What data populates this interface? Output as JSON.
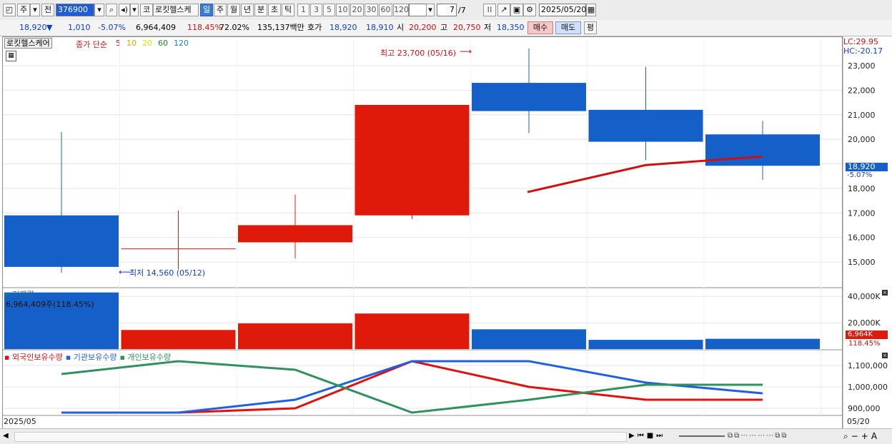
{
  "toolbar": {
    "type_label": "주",
    "prev_label": "전",
    "code": "376900",
    "market_btn": "코",
    "stock_name": "로킷헬스케",
    "periods": [
      "일",
      "주",
      "월",
      "년",
      "분",
      "초",
      "틱"
    ],
    "selected_period": "일",
    "intervals": [
      "1",
      "3",
      "5",
      "10",
      "20",
      "30",
      "60",
      "120"
    ],
    "page": "7",
    "page_total": "/7",
    "date": "2025/05/20"
  },
  "quote": {
    "price": "18,920",
    "arrow": "▼",
    "change": "1,010",
    "change_pct": "-5.07%",
    "volume": "6,964,409",
    "volume_ratio": "118.45%",
    "turnover": "72.02%",
    "amount": "135,137백만",
    "bid_label": "호가",
    "bid1": "18,920",
    "bid2": "18,910",
    "open_label": "시",
    "open": "20,200",
    "high_label": "고",
    "high": "20,750",
    "low_label": "저",
    "low": "18,350",
    "buy_label": "매수",
    "sell_label": "매도",
    "avg_label": "평"
  },
  "price_panel": {
    "name_label": "로킷헬스케어",
    "ma_prefix": "종가 단순",
    "ma_periods": [
      {
        "label": "5",
        "color": "#e01010"
      },
      {
        "label": "10",
        "color": "#f0a000"
      },
      {
        "label": "20",
        "color": "#e8e000"
      },
      {
        "label": "60",
        "color": "#208020"
      },
      {
        "label": "120",
        "color": "#2080c0"
      }
    ],
    "lc": "LC:29.95",
    "hc": "HC:-20.17",
    "high_note": "최고 23,700 (05/16)",
    "low_note": "최저 14,560 (05/12)",
    "last_price_tag": "18,920",
    "last_change_tag": "-5.07%",
    "y_ticks": [
      "23,000",
      "22,000",
      "21,000",
      "20,000",
      "18,000",
      "17,000",
      "16,000",
      "15,000"
    ]
  },
  "volume_panel": {
    "title": "거래량",
    "value_note": "6,964,409주(118.45%)",
    "y_ticks": [
      "40,000K",
      "20,000K"
    ],
    "last_tag": "6,964K",
    "last_pct": "118.45%"
  },
  "holdings_panel": {
    "legend": [
      {
        "label": "외국인보유수량",
        "color": "#e01010"
      },
      {
        "label": "기관보유수량",
        "color": "#2060e0"
      },
      {
        "label": "개인보유수량",
        "color": "#309060"
      }
    ],
    "y_ticks": [
      "1,100,000",
      "1,000,000",
      "900,000"
    ]
  },
  "x_axis": {
    "start": "2025/05",
    "end": "05/20"
  },
  "chart_data": {
    "type": "candlestick",
    "y_range": [
      14000,
      24000
    ],
    "candles": [
      {
        "open": 16900,
        "high": 20300,
        "low": 14560,
        "close": 14800,
        "color": "#1560c8"
      },
      {
        "open": 15550,
        "high": 17100,
        "low": 14700,
        "close": 15550,
        "color": "#e01a0a"
      },
      {
        "open": 15800,
        "high": 17750,
        "low": 15150,
        "close": 16500,
        "color": "#e01a0a"
      },
      {
        "open": 16900,
        "high": 21400,
        "low": 16750,
        "close": 21400,
        "color": "#e01a0a"
      },
      {
        "open": 22300,
        "high": 23700,
        "low": 20250,
        "close": 21150,
        "color": "#1560c8"
      },
      {
        "open": 21200,
        "high": 22950,
        "low": 19150,
        "close": 19900,
        "color": "#1560c8"
      },
      {
        "open": 20200,
        "high": 20750,
        "low": 18350,
        "close": 18920,
        "color": "#1560c8"
      }
    ],
    "ma5": [
      null,
      null,
      null,
      null,
      17850,
      18950,
      19300
    ],
    "volume_max": 45000,
    "volume": [
      {
        "value": 43000,
        "color": "#1560c8"
      },
      {
        "value": 14500,
        "color": "#e01a0a"
      },
      {
        "value": 19500,
        "color": "#e01a0a"
      },
      {
        "value": 27000,
        "color": "#e01a0a"
      },
      {
        "value": 15000,
        "color": "#1560c8"
      },
      {
        "value": 7000,
        "color": "#1560c8"
      },
      {
        "value": 7800,
        "color": "#1560c8"
      }
    ],
    "holdings_range": [
      880000,
      1150000
    ],
    "holdings": [
      {
        "name": "외국인보유수량",
        "color": "#e01010",
        "values": [
          880000,
          880000,
          900000,
          1120000,
          1000000,
          940000,
          940000
        ]
      },
      {
        "name": "기관보유수량",
        "color": "#2060e0",
        "values": [
          880000,
          880000,
          940000,
          1120000,
          1120000,
          1020000,
          970000
        ]
      },
      {
        "name": "개인보유수량",
        "color": "#309060",
        "values": [
          1060000,
          1120000,
          1080000,
          880000,
          940000,
          1010000,
          1010000
        ]
      }
    ]
  }
}
